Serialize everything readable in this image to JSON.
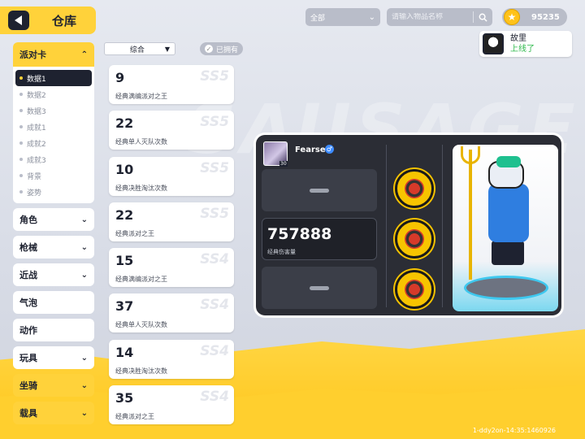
{
  "header": {
    "title": "仓库"
  },
  "topbar": {
    "filter": "全部",
    "search_placeholder": "请输入物品名称",
    "currency": "95235"
  },
  "friend": {
    "name": "故里",
    "status": "上线了"
  },
  "nav": {
    "group": {
      "label": "派对卡",
      "items": [
        "数据1",
        "数据2",
        "数据3",
        "成就1",
        "成就2",
        "成就3",
        "背景",
        "姿势"
      ]
    },
    "buttons": [
      "角色",
      "枪械",
      "近战",
      "气泡",
      "动作",
      "玩具",
      "坐骑",
      "载具"
    ]
  },
  "sort": {
    "label": "综合",
    "owned_label": "已拥有"
  },
  "cards": [
    {
      "value": "9",
      "label": "经典满编派对之王",
      "season": "SS5"
    },
    {
      "value": "22",
      "label": "经典单人灭队次数",
      "season": "SS5"
    },
    {
      "value": "10",
      "label": "经典决胜淘汰次数",
      "season": "SS5"
    },
    {
      "value": "22",
      "label": "经典派对之王",
      "season": "SS5"
    },
    {
      "value": "15",
      "label": "经典满编派对之王",
      "season": "SS4"
    },
    {
      "value": "37",
      "label": "经典单人灭队次数",
      "season": "SS4"
    },
    {
      "value": "14",
      "label": "经典决胜淘汰次数",
      "season": "SS4"
    },
    {
      "value": "35",
      "label": "经典派对之王",
      "season": "SS4"
    }
  ],
  "player": {
    "name": "Fearse.",
    "level": "30",
    "gender_icon": "♂",
    "stat_value": "757888",
    "stat_label": "经典伤害量"
  },
  "footer": {
    "build_id": "1-ddy2on-14:35:1460926"
  },
  "colors": {
    "accent": "#ffd23a",
    "panel": "#2b2d35",
    "online": "#2db84a"
  }
}
